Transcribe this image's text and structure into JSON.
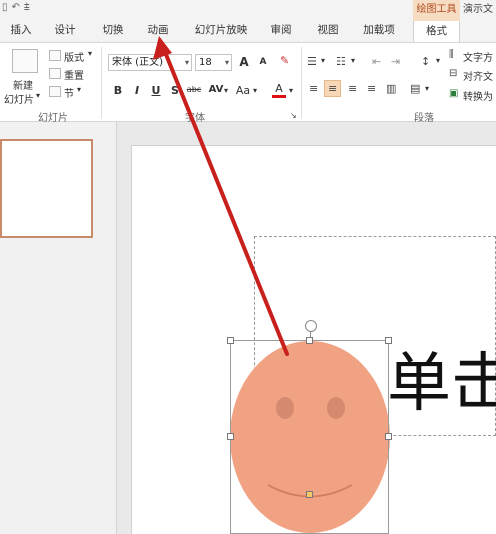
{
  "titlebar": {
    "contextual_label": "绘图工具",
    "doc_title": "演示文"
  },
  "tabs": [
    {
      "label": "插入"
    },
    {
      "label": "设计"
    },
    {
      "label": "切换"
    },
    {
      "label": "动画"
    },
    {
      "label": "幻灯片放映"
    },
    {
      "label": "审阅"
    },
    {
      "label": "视图"
    },
    {
      "label": "加载项"
    },
    {
      "label": "格式"
    }
  ],
  "ribbon": {
    "slides_group": {
      "new_slide_line1": "新建",
      "new_slide_line2": "幻灯片",
      "layout": "版式",
      "reset": "重置",
      "section": "节",
      "label": "幻灯片"
    },
    "font_group": {
      "font_name": "宋体 (正文)",
      "font_size": "18",
      "bold": "B",
      "italic": "I",
      "underline": "U",
      "shadow": "S",
      "strike": "abc",
      "spacing": "AV",
      "case": "Aa",
      "color_letter": "A",
      "grow": "A",
      "shrink": "A",
      "label": "字体"
    },
    "paragraph_group": {
      "text_direction": "文字方",
      "align_text": "对齐文",
      "convert": "转换为",
      "label": "段落"
    }
  },
  "slide": {
    "text": "单击"
  },
  "colors": {
    "accent": "#f7dcc4",
    "arrow": "#c8201c",
    "face": "#f0a283",
    "eyes": "#d58a70"
  },
  "annotation": {
    "type": "arrow",
    "points_to": "动画"
  }
}
